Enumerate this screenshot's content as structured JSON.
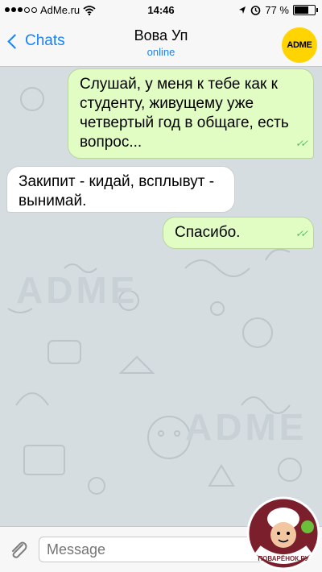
{
  "status_bar": {
    "carrier": "AdMe.ru",
    "time": "14:46",
    "battery": "77 %",
    "battery_level": 0.77
  },
  "nav": {
    "back_label": "Chats",
    "title": "Вова Уп",
    "status": "online",
    "avatar_text": "ADME"
  },
  "background": {
    "watermark": "ADME"
  },
  "messages": [
    {
      "direction": "outgoing",
      "text": "Слушай, у меня к тебе как к студенту, живущему уже четвертый год в общаге, есть вопрос..."
    },
    {
      "direction": "incoming",
      "text": "Закипит - кидай, всплывут - вынимай."
    },
    {
      "direction": "outgoing",
      "text": "Спасибо."
    }
  ],
  "input": {
    "placeholder": "Message"
  },
  "logo": {
    "text": "ПОВАРЁНОК.РУ"
  }
}
